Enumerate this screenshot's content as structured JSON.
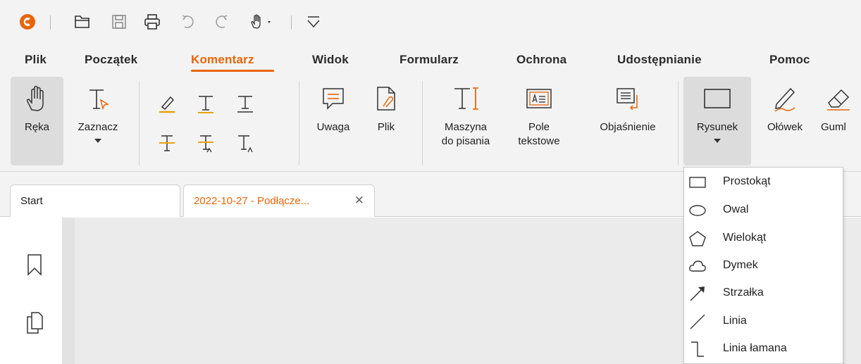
{
  "quick_access": {
    "icons": [
      "app-logo-icon",
      "open-folder-icon",
      "save-icon",
      "print-icon",
      "undo-icon",
      "redo-icon",
      "hand-tool-dropdown-icon",
      "customize-toolbar-icon"
    ]
  },
  "menu": {
    "items": [
      {
        "label": "Plik",
        "active": false
      },
      {
        "label": "Początek",
        "active": false
      },
      {
        "label": "Komentarz",
        "active": true
      },
      {
        "label": "Widok",
        "active": false
      },
      {
        "label": "Formularz",
        "active": false
      },
      {
        "label": "Ochrona",
        "active": false
      },
      {
        "label": "Udostępnianie",
        "active": false
      },
      {
        "label": "Pomoc",
        "active": false
      }
    ]
  },
  "ribbon": {
    "hand": "Ręka",
    "select": "Zaznacz",
    "note": "Uwaga",
    "file": "Plik",
    "typewriter_line1": "Maszyna",
    "typewriter_line2": "do pisania",
    "textbox_line1": "Pole",
    "textbox_line2": "tekstowe",
    "callout": "Objaśnienie",
    "drawing": "Rysunek",
    "pencil": "Ołówek",
    "eraser": "Guml"
  },
  "tabs": {
    "start": "Start",
    "document": "2022-10-27 - Podłącze...",
    "close_glyph": "✕"
  },
  "drawing_menu": {
    "items": [
      {
        "label": "Prostokąt",
        "icon": "rectangle-icon"
      },
      {
        "label": "Owal",
        "icon": "oval-icon"
      },
      {
        "label": "Wielokąt",
        "icon": "polygon-icon"
      },
      {
        "label": "Dymek",
        "icon": "cloud-icon"
      },
      {
        "label": "Strzałka",
        "icon": "arrow-icon"
      },
      {
        "label": "Linia",
        "icon": "line-icon"
      },
      {
        "label": "Linia łamana",
        "icon": "polyline-icon"
      }
    ]
  },
  "colors": {
    "accent": "#e8650a",
    "highlight_underline": "#e8a20a",
    "background": "#f3f3f3",
    "canvas": "#ebebeb"
  }
}
